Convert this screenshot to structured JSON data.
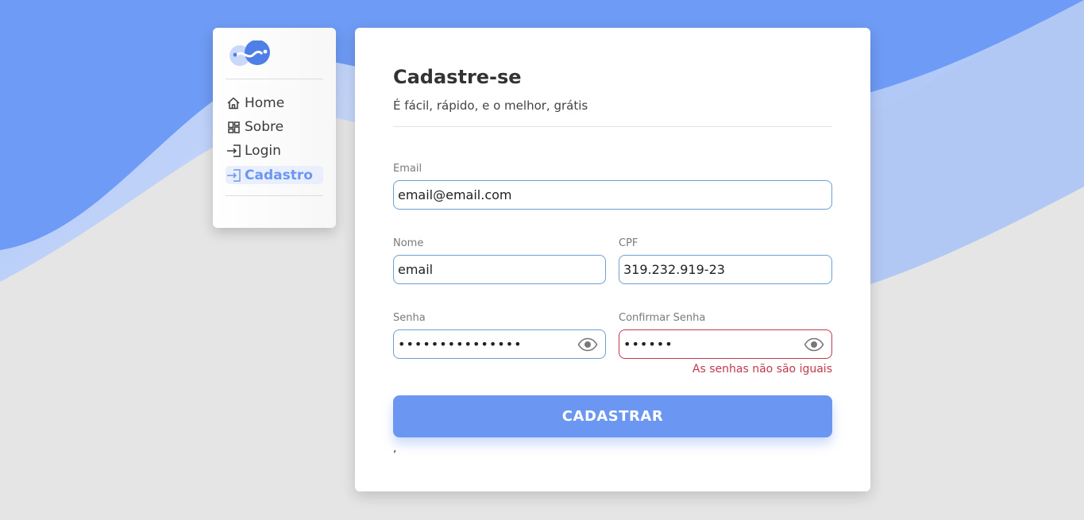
{
  "sidebar": {
    "items": [
      {
        "label": "Home",
        "icon": "home-icon"
      },
      {
        "label": "Sobre",
        "icon": "dashboard-icon"
      },
      {
        "label": "Login",
        "icon": "login-icon"
      },
      {
        "label": "Cadastro",
        "icon": "login-icon",
        "active": true
      }
    ]
  },
  "form": {
    "title": "Cadastre-se",
    "subtitle": "É fácil, rápido, e o melhor, grátis",
    "email": {
      "label": "Email",
      "value": "email@email.com"
    },
    "nome": {
      "label": "Nome",
      "value": "email"
    },
    "cpf": {
      "label": "CPF",
      "value": "319.232.919-23"
    },
    "senha": {
      "label": "Senha",
      "masked": "•••••••••••••••"
    },
    "confirmar": {
      "label": "Confirmar Senha",
      "masked": "••••••",
      "error": "As senhas não são iguais"
    },
    "submit_label": "CADASTRAR",
    "trailing_text": ","
  },
  "colors": {
    "accent": "#6b97f2",
    "wave_top": "#6e9bf5",
    "error": "#c0394d",
    "background": "#e5e5e5"
  }
}
